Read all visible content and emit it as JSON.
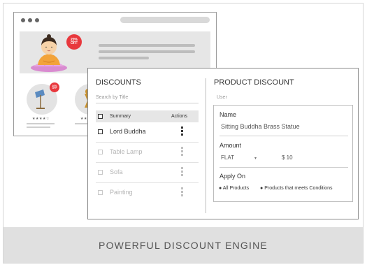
{
  "hero_badge": {
    "line1": "20%",
    "line2": "OFF"
  },
  "product_badge": {
    "line1": "10%",
    "line2": "OFF"
  },
  "product_rating": "★★★★☆",
  "discounts": {
    "title": "DISCOUNTS",
    "search_placeholder": "Search by Title",
    "columns": {
      "summary": "Summary",
      "actions": "Actions"
    },
    "rows": [
      {
        "label": "Lord Buddha",
        "active": true
      },
      {
        "label": "Table Lamp",
        "active": false
      },
      {
        "label": "Sofa",
        "active": false
      },
      {
        "label": "Painting",
        "active": false
      }
    ]
  },
  "product_discount": {
    "title": "PRODUCT DISCOUNT",
    "user_label": "User",
    "name_label": "Name",
    "name_value": "Sitting Buddha Brass Statue",
    "amount_label": "Amount",
    "amount_type": "FLAT",
    "amount_value": "$ 10",
    "apply_label": "Apply On",
    "apply_options": [
      "All Products",
      "Products that meets Conditions"
    ]
  },
  "footer": "POWERFUL DISCOUNT ENGINE",
  "colors": {
    "badge": "#e8383d",
    "lamp_shade": "#5b8bc0",
    "statue": "#f2a33a"
  }
}
